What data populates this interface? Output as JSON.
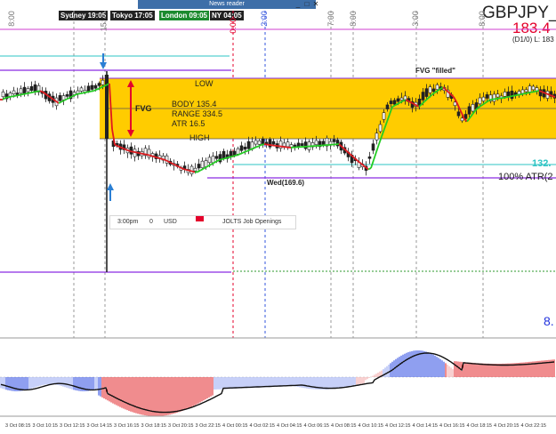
{
  "header": {
    "news_label": "News reader",
    "symbol": "GBPJPY_",
    "price": "183.4",
    "d1_info": "(D1/0) L: 183"
  },
  "sessions": [
    {
      "label": "Sydney 19:05",
      "color": "#222222"
    },
    {
      "label": "Tokyo 17:05",
      "color": "#222222"
    },
    {
      "label": "London 09:05",
      "color": "#1b8a2e"
    },
    {
      "label": "NY 04:05",
      "color": "#222222"
    }
  ],
  "window_buttons": [
    "_",
    "□",
    "✕"
  ],
  "time_markers": [
    "8:00",
    "15:",
    "0:00",
    "2:00",
    "7:00",
    "8:00",
    "3:00",
    "8:00",
    "15:00"
  ],
  "fvg": {
    "tag": "FVG",
    "low_label": "LOW",
    "high_label": "HIGH",
    "body": "BODY 135.4",
    "range": "RANGE 334.5",
    "atr": "ATR 16.5",
    "filled_label": "FVG \"filled\"",
    "zone_color": "#ffcc00"
  },
  "annotations": {
    "wed_label": "Wed(169.6)",
    "right_value_green": "132.",
    "right_atr": "100% ATR(2",
    "right_blue": "8."
  },
  "event": {
    "time": "3:00pm",
    "index": "0",
    "currency": "USD",
    "title": "JOLTS Job Openings"
  },
  "x_axis": [
    "3 Oct 08:15",
    "3 Oct 10:15",
    "3 Oct 12:15",
    "3 Oct 14:15",
    "3 Oct 16:15",
    "3 Oct 18:15",
    "3 Oct 20:15",
    "3 Oct 22:15",
    "4 Oct 00:15",
    "4 Oct 02:15",
    "4 Oct 04:15",
    "4 Oct 06:15",
    "4 Oct 08:15",
    "4 Oct 10:15",
    "4 Oct 12:15",
    "4 Oct 14:15",
    "4 Oct 16:15",
    "4 Oct 18:15",
    "4 Oct 20:15",
    "4 Oct 22:15"
  ],
  "colors": {
    "accent_red": "#e4002b",
    "ma_green": "#22cc22",
    "ma_red": "#e0191e",
    "purple_level": "#8a2be2",
    "cyan_level": "#2ec4c4",
    "macd_blue": "#1f3fe0",
    "macd_red": "#e0191e"
  }
}
